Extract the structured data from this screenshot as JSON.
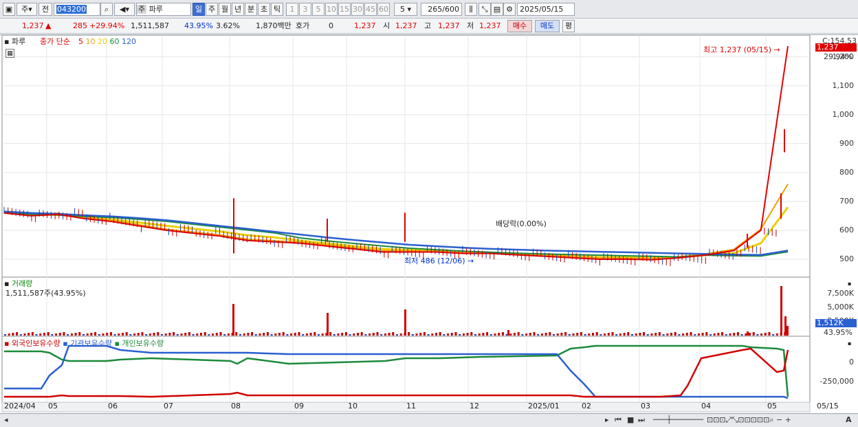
{
  "toolbar": {
    "market": "주",
    "prev": "전",
    "code": "043200",
    "name_tag": "주",
    "name": "파루",
    "periods": [
      "일",
      "주",
      "월",
      "년",
      "분",
      "초",
      "틱"
    ],
    "active_period": "일",
    "intervals": [
      "1",
      "3",
      "5",
      "10",
      "15",
      "30",
      "45",
      "60"
    ],
    "interval_value": "5",
    "count": "265",
    "count_total": "/600",
    "date": "2025/05/15"
  },
  "quote": {
    "price": "1,237",
    "up_arrow": "▲",
    "change": "285",
    "change_pct": "+29.94%",
    "volume": "1,511,587",
    "vol_ratio": "43.95%",
    "turnover": "3.62%",
    "amount": "1,870백만",
    "hoga_label": "호가",
    "hoga_value": "0",
    "hoga_price": "1,237",
    "open_label": "시",
    "open": "1,237",
    "high_label": "고",
    "high": "1,237",
    "low_label": "저",
    "low": "1,237",
    "buy": "매수",
    "sell": "매도",
    "eval": "평"
  },
  "price_panel": {
    "title": "파루",
    "ma_label": "종가 단순",
    "ma_periods": [
      "5",
      "10",
      "20",
      "60",
      "120"
    ],
    "ma_colors": [
      "#e00000",
      "#f0a000",
      "#e8d000",
      "#1b8a3a",
      "#2a5fd0"
    ],
    "high_note": "최고 1,237 (05/15)",
    "low_note": "최저 486 (12/06)",
    "event_note": "배당락(0.00%)",
    "axis_top": "C:154.53",
    "price_box": "1,237",
    "pct_box": "29.94%",
    "ticks": [
      "1,200",
      "1,100",
      "1,000",
      "900",
      "800",
      "700",
      "600",
      "500"
    ]
  },
  "volume_panel": {
    "title": "거래량",
    "value": "1,511,587주(43.95%)",
    "ticks": [
      "7,500K",
      "5,000K",
      "2,500K"
    ],
    "box": "1,512K",
    "pct": "43.95%"
  },
  "holding_panel": {
    "legend": [
      {
        "name": "외국인보유수량",
        "color": "#d00000"
      },
      {
        "name": "기관보유수량",
        "color": "#2a5fd0"
      },
      {
        "name": "개인보유수량",
        "color": "#1b8a3a"
      }
    ],
    "ticks": [
      "0",
      "-250,000"
    ]
  },
  "x_axis": {
    "labels": [
      "2024/04",
      "05",
      "06",
      "07",
      "08",
      "09",
      "10",
      "11",
      "12",
      "2025/01",
      "02",
      "03",
      "04",
      "05",
      "05/15"
    ]
  },
  "chart_data": [
    {
      "type": "line",
      "title": "파루",
      "series": [
        {
          "name": "5",
          "values": [
            660,
            650,
            655,
            640,
            630,
            615,
            600,
            590,
            580,
            565,
            560,
            555,
            545,
            535,
            525,
            525,
            525,
            520,
            520,
            515,
            510,
            505,
            500,
            500,
            498,
            505,
            515,
            530,
            600,
            1237
          ]
        },
        {
          "name": "120",
          "values": [
            665,
            660,
            657,
            652,
            648,
            642,
            635,
            625,
            615,
            605,
            595,
            585,
            575,
            566,
            558,
            550,
            545,
            540,
            536,
            533,
            530,
            528,
            526,
            524,
            522,
            520,
            518,
            516,
            515,
            530
          ]
        }
      ],
      "ylim": [
        480,
        1240
      ],
      "annotations": [
        "최고 1,237 (05/15)",
        "최저 486 (12/06)",
        "배당락(0.00%)"
      ]
    }
  ]
}
